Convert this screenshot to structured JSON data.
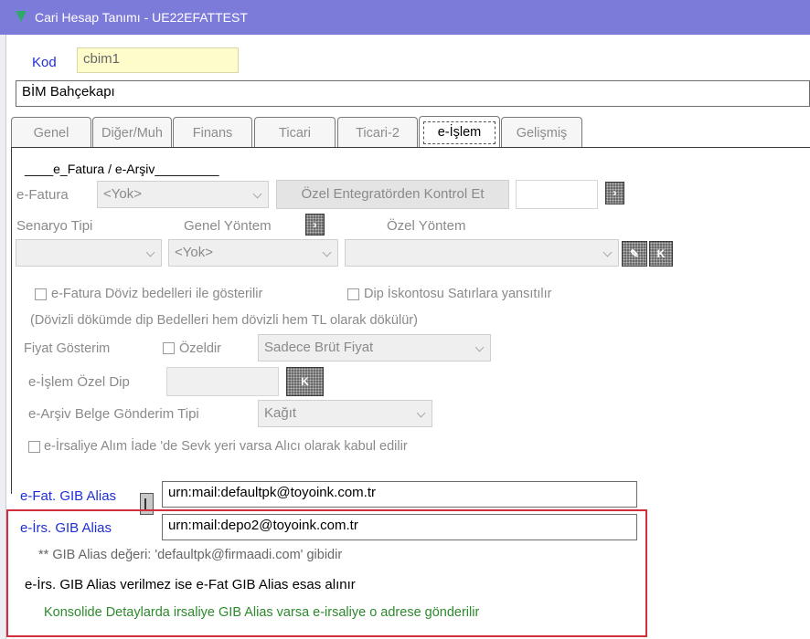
{
  "window": {
    "title": "Cari Hesap Tanımı - UE22EFATTEST"
  },
  "header": {
    "kod_label": "Kod",
    "kod_value": "cbim1",
    "name_value": "BİM Bahçekapı"
  },
  "tabs": [
    {
      "label": "Genel"
    },
    {
      "label": "Diğer/Muh"
    },
    {
      "label": "Finans"
    },
    {
      "label": "Ticari"
    },
    {
      "label": "Ticari-2"
    },
    {
      "label": "e-İşlem"
    },
    {
      "label": "Gelişmiş"
    }
  ],
  "efatura": {
    "section_title": "____e_Fatura / e-Arşiv_________",
    "efatura_label": "e-Fatura",
    "efatura_value": "<Yok>",
    "control_button": "Özel Entegratörden Kontrol Et",
    "senaryo_label": "Senaryo Tipi",
    "genel_yontem_label": "Genel Yöntem",
    "ozel_yontem_label": "Özel Yöntem",
    "genel_yontem_value": "<Yok>",
    "ozel_button_label": "K"
  },
  "options": {
    "doviz_label": "e-Fatura Döviz bedelleri ile gösterilir",
    "dip_label": "Dip İskontosu Satırlara yansıtılır",
    "doviz_note": "(Dövizli dökümde dip Bedelleri hem dövizli hem TL olarak dökülür)",
    "fiyat_label": "Fiyat Gösterim",
    "ozeldir_label": "Özeldir",
    "fiyat_value": "Sadece Brüt Fiyat",
    "ozel_dip_label": "e-İşlem Özel Dip",
    "ozel_dip_button": "K",
    "earsiv_label": "e-Arşiv Belge Gönderim Tipi",
    "earsiv_value": "Kağıt",
    "irsaliye_label": "e-İrsaliye Alım İade 'de Sevk yeri varsa Alıcı olarak kabul edilir"
  },
  "alias": {
    "efat_label": "e-Fat. GIB Alias",
    "efat_value": "urn:mail:defaultpk@toyoink.com.tr",
    "eirs_label": "e-İrs. GIB Alias",
    "eirs_value": "urn:mail:depo2@toyoink.com.tr",
    "hint": "** GIB Alias değeri: 'defaultpk@firmaadi.com' gibidir",
    "note": "e-İrs. GIB Alias verilmez ise e-Fat GIB Alias esas alınır",
    "green_note": "Konsolide Detaylarda irsaliye GIB Alias varsa e-irsaliye o adrese gönderilir"
  },
  "colors": {
    "titlebar": "#7d7bd9",
    "label_blue": "#1f2fd6",
    "highlight_red": "#d0303a",
    "note_green": "#2c8a2c",
    "kod_bg": "#fffccc"
  }
}
